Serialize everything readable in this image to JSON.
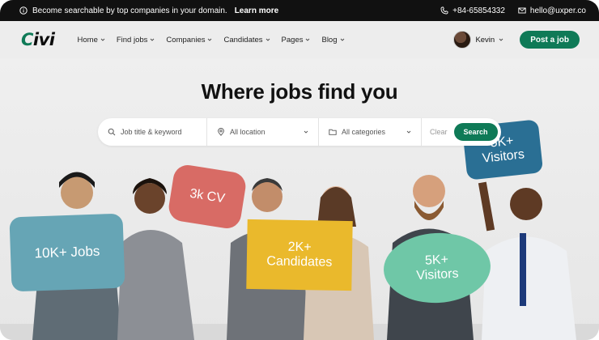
{
  "topbar": {
    "notice_text": "Become searchable by top companies in your domain.",
    "notice_link": "Learn more",
    "phone": "+84-65854332",
    "email": "hello@uxper.co"
  },
  "header": {
    "logo_first": "C",
    "logo_rest": "ivi",
    "nav": [
      {
        "label": "Home"
      },
      {
        "label": "Find jobs"
      },
      {
        "label": "Companies"
      },
      {
        "label": "Candidates"
      },
      {
        "label": "Pages"
      },
      {
        "label": "Blog"
      }
    ],
    "user_name": "Kevin",
    "post_job_label": "Post a job"
  },
  "hero": {
    "title": "Where jobs find you",
    "search": {
      "keyword_placeholder": "Job title & keyword",
      "location_value": "All location",
      "category_value": "All categories",
      "clear_label": "Clear",
      "search_label": "Search"
    },
    "signs": {
      "jobs": "10K+ Jobs",
      "cv": "3k CV",
      "candidates_line1": "2K+",
      "candidates_line2": "Candidates",
      "visitors_line1": "5K+",
      "visitors_line2": "Visitors",
      "visitors_top_line1": "5K+",
      "visitors_top_line2": "Visitors"
    }
  },
  "colors": {
    "brand": "#0f7a57",
    "jobs_sign": "#66a5b5",
    "cv_sign": "#d86b65",
    "candidates_sign": "#eab92c",
    "visitors_sign": "#6fc7a7",
    "visitors_top_sign": "#2a6f94"
  }
}
